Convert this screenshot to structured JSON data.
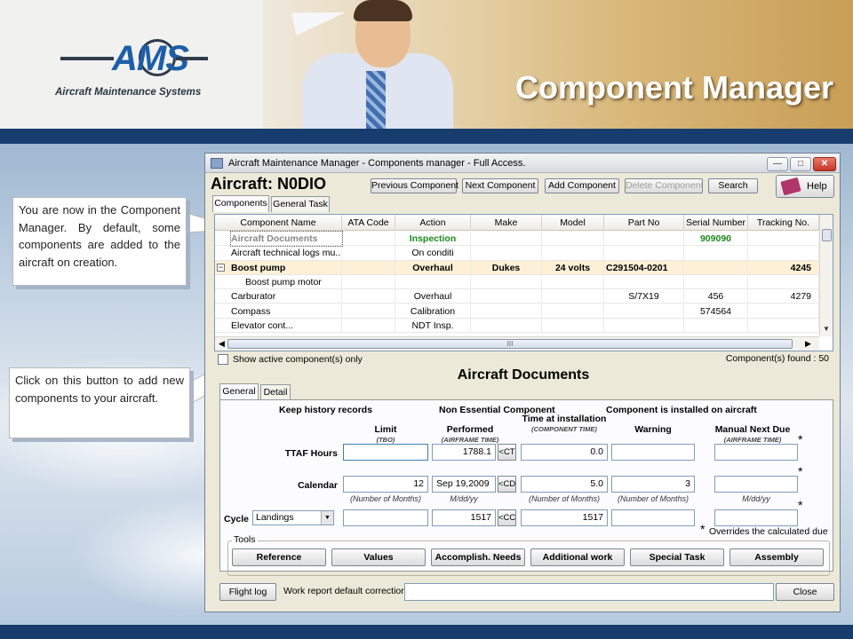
{
  "slide": {
    "title": "Component Manager",
    "logo": {
      "letters": "AMS",
      "subtitle": "Aircraft Maintenance Systems"
    },
    "callout_1": "You are now in the Component Manager. By default, some components are added to the aircraft on creation.",
    "callout_2": "Click on this button to add new components to your aircraft."
  },
  "window": {
    "title": "Aircraft Maintenance Manager - Components manager - Full Access.",
    "aircraft_label": "Aircraft: N0DIO",
    "toolbar": {
      "previous": "Previous Component",
      "next": "Next Component",
      "add": "Add Component",
      "delete": "Delete Component",
      "search": "Search",
      "help": "Help"
    },
    "tabs": [
      "Components",
      "General Task"
    ],
    "grid": {
      "columns": [
        "Component Name",
        "ATA Code",
        "Action",
        "Make",
        "Model",
        "Part No",
        "Serial Number",
        "Tracking No."
      ],
      "rows": [
        {
          "name": "Aircraft Documents",
          "ata": "",
          "action": "Inspection",
          "make": "",
          "model": "",
          "part": "",
          "serial": "909090",
          "tracking": ""
        },
        {
          "name": "Aircraft technical logs mu...",
          "ata": "",
          "action": "On conditi",
          "make": "",
          "model": "",
          "part": "",
          "serial": "",
          "tracking": ""
        },
        {
          "name": "Boost pump",
          "ata": "",
          "action": "Overhaul",
          "make": "Dukes",
          "model": "24 volts",
          "part": "C291504-0201",
          "serial": "",
          "tracking": "4245"
        },
        {
          "name": "Boost pump motor",
          "ata": "",
          "action": "",
          "make": "",
          "model": "",
          "part": "",
          "serial": "",
          "tracking": ""
        },
        {
          "name": "Carburator",
          "ata": "",
          "action": "Overhaul",
          "make": "",
          "model": "",
          "part": "S/7X19",
          "serial": "456",
          "tracking": "4279"
        },
        {
          "name": "Compass",
          "ata": "",
          "action": "Calibration",
          "make": "",
          "model": "",
          "part": "",
          "serial": "574564",
          "tracking": ""
        },
        {
          "name": "Elevator cont...",
          "ata": "",
          "action": "NDT Insp.",
          "make": "",
          "model": "",
          "part": "",
          "serial": "",
          "tracking": ""
        }
      ],
      "hscroll_grip": "III"
    },
    "show_active": "Show active component(s) only",
    "components_found": "Component(s) found : 50",
    "detail": {
      "title": "Aircraft Documents",
      "tabs": [
        "General",
        "Detail"
      ],
      "flags": [
        "Keep history records",
        "Non Essential Component",
        "Component is installed on aircraft"
      ],
      "headers": {
        "limit": "Limit",
        "limit_sub": "(TBO)",
        "performed": "Performed",
        "performed_sub": "(AIRFRAME TIME)",
        "time_at_installation": "Time at installation",
        "time_sub": "(COMPONENT TIME)",
        "warning": "Warning",
        "manual_next_due": "Manual Next Due",
        "manual_sub": "(AIRFRAME TIME)"
      },
      "ttaf": {
        "label": "TTAF Hours",
        "limit": "",
        "performed": "1788.1",
        "btn": "<CT",
        "time": "0.0",
        "warning": "",
        "manual": ""
      },
      "calendar": {
        "label": "Calendar",
        "limit": "12",
        "performed": "Sep 19,2009",
        "btn": "<CD",
        "time": "5.0",
        "warning": "3",
        "manual": ""
      },
      "calendar_units": [
        "(Number of Months)",
        "M/dd/yy",
        "(Number of Months)",
        "(Number of Months)",
        "M/dd/yy"
      ],
      "cycle": {
        "label": "Cycle",
        "select": "Landings",
        "limit": "",
        "performed": "1517",
        "btn": "<CC",
        "time": "1517",
        "warning": "",
        "manual": ""
      },
      "asterisk": "*",
      "overrides_note": "Overrides the calculated due",
      "tools_label": "Tools",
      "tools": [
        "Reference",
        "Values",
        "Accomplish. Needs",
        "Additional work",
        "Special Task",
        "Assembly"
      ]
    },
    "footer": {
      "flight_log": "Flight log",
      "work_report_label": "Work report default correction",
      "close": "Close"
    }
  }
}
